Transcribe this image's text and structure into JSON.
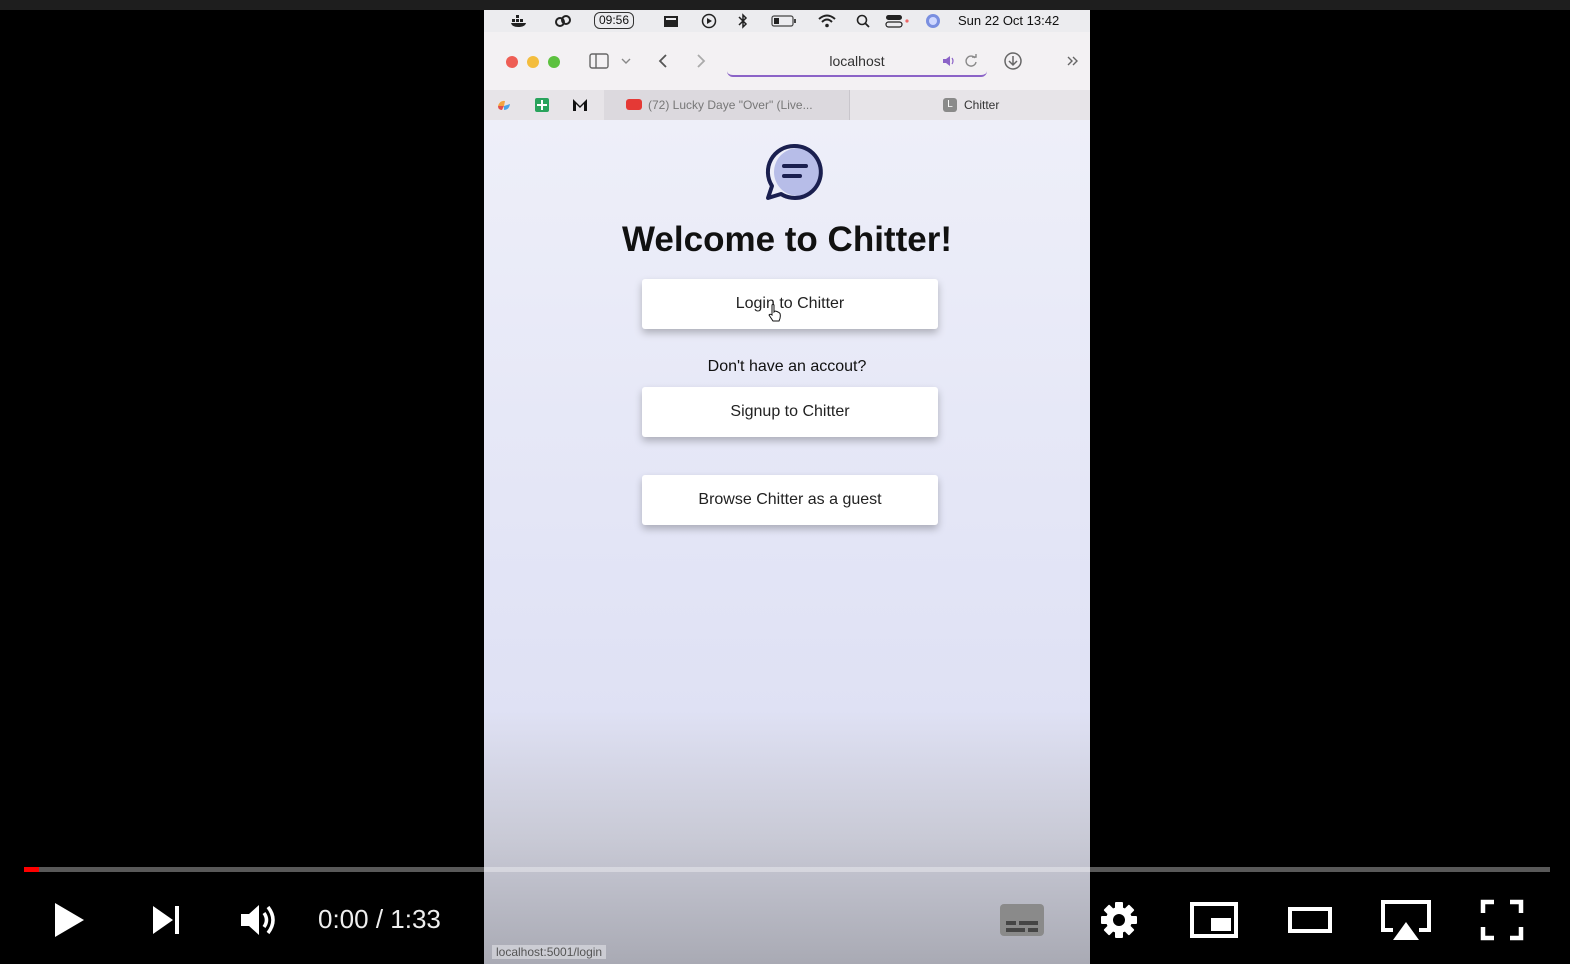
{
  "menubar": {
    "time_pill": "09:56",
    "clock": "Sun 22 Oct  13:42"
  },
  "browser": {
    "url": "localhost",
    "tabs": [
      {
        "label": "(72) Lucky Daye \"Over\" (Live..."
      },
      {
        "label": "Chitter",
        "favicon_letter": "L"
      }
    ]
  },
  "page": {
    "title": "Welcome to Chitter!",
    "login_label": "Login to Chitter",
    "hint": "Don't have an accout?",
    "signup_label": "Signup to Chitter",
    "guest_label": "Browse Chitter as a guest",
    "status_url": "localhost:5001/login"
  },
  "player": {
    "current_time": "0:00",
    "separator": " / ",
    "duration": "1:33",
    "progress_fraction": 0.01
  },
  "colors": {
    "accent_url": "#8b63c7",
    "progress": "#ff0000",
    "logo": "#1a1f4f"
  }
}
